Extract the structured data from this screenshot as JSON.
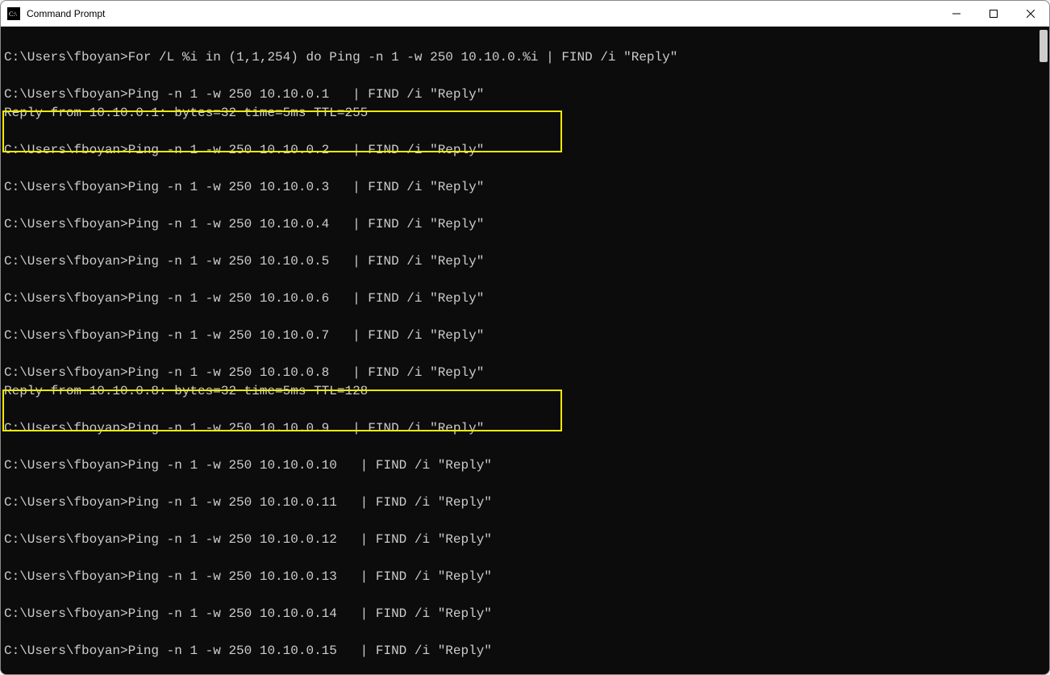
{
  "window": {
    "title": "Command Prompt"
  },
  "prompt": "C:\\Users\\fboyan>",
  "lines": [
    {
      "t": "space"
    },
    {
      "t": "cmd",
      "text": "C:\\Users\\fboyan>For /L %i in (1,1,254) do Ping -n 1 -w 250 10.10.0.%i | FIND /i \"Reply\""
    },
    {
      "t": "space"
    },
    {
      "t": "cmd",
      "text": "C:\\Users\\fboyan>Ping -n 1 -w 250 10.10.0.1   | FIND /i \"Reply\""
    },
    {
      "t": "out",
      "text": "Reply from 10.10.0.1: bytes=32 time=5ms TTL=255"
    },
    {
      "t": "space"
    },
    {
      "t": "cmd",
      "text": "C:\\Users\\fboyan>Ping -n 1 -w 250 10.10.0.2   | FIND /i \"Reply\""
    },
    {
      "t": "space"
    },
    {
      "t": "cmd",
      "text": "C:\\Users\\fboyan>Ping -n 1 -w 250 10.10.0.3   | FIND /i \"Reply\""
    },
    {
      "t": "space"
    },
    {
      "t": "cmd",
      "text": "C:\\Users\\fboyan>Ping -n 1 -w 250 10.10.0.4   | FIND /i \"Reply\""
    },
    {
      "t": "space"
    },
    {
      "t": "cmd",
      "text": "C:\\Users\\fboyan>Ping -n 1 -w 250 10.10.0.5   | FIND /i \"Reply\""
    },
    {
      "t": "space"
    },
    {
      "t": "cmd",
      "text": "C:\\Users\\fboyan>Ping -n 1 -w 250 10.10.0.6   | FIND /i \"Reply\""
    },
    {
      "t": "space"
    },
    {
      "t": "cmd",
      "text": "C:\\Users\\fboyan>Ping -n 1 -w 250 10.10.0.7   | FIND /i \"Reply\""
    },
    {
      "t": "space"
    },
    {
      "t": "cmd",
      "text": "C:\\Users\\fboyan>Ping -n 1 -w 250 10.10.0.8   | FIND /i \"Reply\""
    },
    {
      "t": "out",
      "text": "Reply from 10.10.0.8: bytes=32 time=5ms TTL=128"
    },
    {
      "t": "space"
    },
    {
      "t": "cmd",
      "text": "C:\\Users\\fboyan>Ping -n 1 -w 250 10.10.0.9   | FIND /i \"Reply\""
    },
    {
      "t": "space"
    },
    {
      "t": "cmd",
      "text": "C:\\Users\\fboyan>Ping -n 1 -w 250 10.10.0.10   | FIND /i \"Reply\""
    },
    {
      "t": "space"
    },
    {
      "t": "cmd",
      "text": "C:\\Users\\fboyan>Ping -n 1 -w 250 10.10.0.11   | FIND /i \"Reply\""
    },
    {
      "t": "space"
    },
    {
      "t": "cmd",
      "text": "C:\\Users\\fboyan>Ping -n 1 -w 250 10.10.0.12   | FIND /i \"Reply\""
    },
    {
      "t": "space"
    },
    {
      "t": "cmd",
      "text": "C:\\Users\\fboyan>Ping -n 1 -w 250 10.10.0.13   | FIND /i \"Reply\""
    },
    {
      "t": "space"
    },
    {
      "t": "cmd",
      "text": "C:\\Users\\fboyan>Ping -n 1 -w 250 10.10.0.14   | FIND /i \"Reply\""
    },
    {
      "t": "space"
    },
    {
      "t": "cmd",
      "text": "C:\\Users\\fboyan>Ping -n 1 -w 250 10.10.0.15   | FIND /i \"Reply\""
    }
  ],
  "highlights": [
    {
      "class": "hl1"
    },
    {
      "class": "hl2"
    }
  ]
}
